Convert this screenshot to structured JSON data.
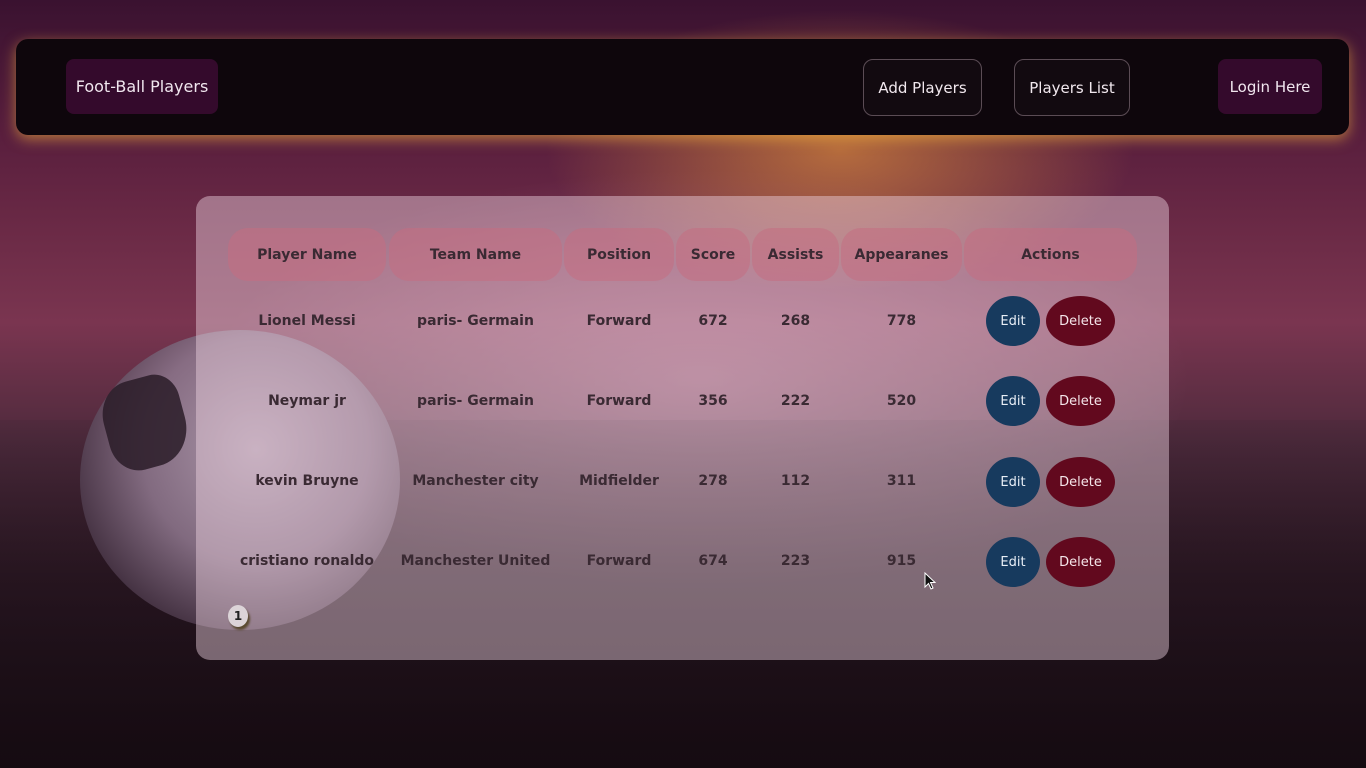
{
  "navbar": {
    "brand": "Foot-Ball Players",
    "add_players": "Add Players",
    "players_list": "Players List",
    "login": "Login Here"
  },
  "table": {
    "headers": [
      "Player Name",
      "Team Name",
      "Position",
      "Score",
      "Assists",
      "Appearanes",
      "Actions"
    ],
    "rows": [
      {
        "player": "Lionel Messi",
        "team": "paris- Germain",
        "position": "Forward",
        "score": "672",
        "assists": "268",
        "appearances": "778"
      },
      {
        "player": "Neymar jr",
        "team": "paris- Germain",
        "position": "Forward",
        "score": "356",
        "assists": "222",
        "appearances": "520"
      },
      {
        "player": "kevin Bruyne",
        "team": "Manchester city",
        "position": "Midfielder",
        "score": "278",
        "assists": "112",
        "appearances": "311"
      },
      {
        "player": "cristiano ronaldo",
        "team": "Manchester United",
        "position": "Forward",
        "score": "674",
        "assists": "223",
        "appearances": "915"
      }
    ],
    "edit_label": "Edit",
    "delete_label": "Delete"
  },
  "pagination": {
    "current_page": "1"
  },
  "colors": {
    "navbar_bg": "#0e060c",
    "brand_bg": "#340a2c",
    "edit_button": "#173a5e",
    "delete_button": "#62091e",
    "header_cell": "#c46e82"
  }
}
